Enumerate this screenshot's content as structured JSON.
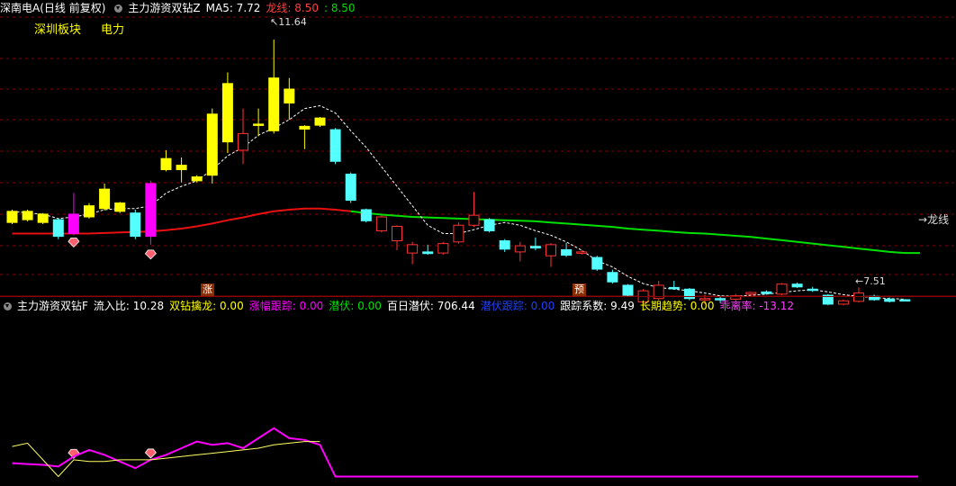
{
  "header1": {
    "stock": "深南电A(日线 前复权)",
    "indicator": "主力游资双钻Z",
    "ma5_label": "MA5: 7.72",
    "dragon_label": "龙线: 8.50",
    "dragon_value": ": 8.50"
  },
  "tags": {
    "sector": "深圳板块",
    "concept": "电力"
  },
  "annotations": {
    "high": "11.64",
    "low": "7.51",
    "dragon_line": "龙线"
  },
  "markers": {
    "zhang": "涨",
    "yu": "预"
  },
  "header2": {
    "indicator": "主力游资双钻F",
    "flow": "流入比: 10.28",
    "double_drill": "双钻擒龙: 0.00",
    "rise_track": "涨幅跟踪: 0.00",
    "lurk": "潜伏: 0.00",
    "hundred_lurk": "百日潜伏: 706.44",
    "lurk_track": "潜伏跟踪: 0.00",
    "track_coef": "跟踪系数: 9.49",
    "long_trend": "长期趋势: 0.00",
    "deviation": "乖离率: -13.12"
  },
  "colors": {
    "up_yellow": "#ffff00",
    "up_red": "#ff3232",
    "down_cyan": "#54ffff",
    "magenta": "#ff00ff",
    "dragon_red": "#e81010",
    "dragon_green": "#00e000",
    "grid": "#8b0000"
  },
  "chart_data": {
    "type": "candlestick",
    "price_range": [
      7.3,
      11.9
    ],
    "candles": [
      {
        "o": 8.35,
        "c": 8.55,
        "h": 8.58,
        "l": 8.32,
        "s": "yellow"
      },
      {
        "o": 8.4,
        "c": 8.55,
        "h": 8.58,
        "l": 8.37,
        "s": "yellow"
      },
      {
        "o": 8.35,
        "c": 8.5,
        "h": 8.52,
        "l": 8.32,
        "s": "yellow"
      },
      {
        "o": 8.4,
        "c": 8.1,
        "h": 8.42,
        "l": 8.05,
        "s": "cyan"
      },
      {
        "o": 8.15,
        "c": 8.5,
        "h": 8.88,
        "l": 8.12,
        "s": "magenta"
      },
      {
        "o": 8.45,
        "c": 8.65,
        "h": 8.7,
        "l": 8.42,
        "s": "yellow"
      },
      {
        "o": 8.6,
        "c": 8.95,
        "h": 9.05,
        "l": 8.57,
        "s": "yellow"
      },
      {
        "o": 8.55,
        "c": 8.7,
        "h": 8.72,
        "l": 8.52,
        "s": "yellow"
      },
      {
        "o": 8.52,
        "c": 8.1,
        "h": 8.58,
        "l": 8.05,
        "s": "cyan"
      },
      {
        "o": 8.1,
        "c": 9.05,
        "h": 9.1,
        "l": 7.95,
        "s": "magenta"
      },
      {
        "o": 9.3,
        "c": 9.5,
        "h": 9.65,
        "l": 9.27,
        "s": "yellow"
      },
      {
        "o": 9.3,
        "c": 9.38,
        "h": 9.52,
        "l": 9.07,
        "s": "yellow"
      },
      {
        "o": 9.1,
        "c": 9.17,
        "h": 9.2,
        "l": 9.07,
        "s": "yellow"
      },
      {
        "o": 9.2,
        "c": 10.3,
        "h": 10.4,
        "l": 9.05,
        "s": "yellow"
      },
      {
        "o": 9.8,
        "c": 10.85,
        "h": 11.05,
        "l": 9.6,
        "s": "yellow"
      },
      {
        "o": 9.65,
        "c": 9.95,
        "h": 10.4,
        "l": 9.4,
        "s": "red"
      },
      {
        "o": 10.1,
        "c": 10.12,
        "h": 10.4,
        "l": 9.9,
        "s": "yellow"
      },
      {
        "o": 10.0,
        "c": 10.95,
        "h": 11.64,
        "l": 9.95,
        "s": "yellow"
      },
      {
        "o": 10.5,
        "c": 10.75,
        "h": 10.95,
        "l": 10.2,
        "s": "yellow"
      },
      {
        "o": 10.03,
        "c": 10.08,
        "h": 10.1,
        "l": 9.67,
        "s": "yellow"
      },
      {
        "o": 10.1,
        "c": 10.23,
        "h": 10.25,
        "l": 10.07,
        "s": "yellow"
      },
      {
        "o": 10.02,
        "c": 9.45,
        "h": 10.05,
        "l": 9.4,
        "s": "cyan"
      },
      {
        "o": 9.22,
        "c": 8.75,
        "h": 9.25,
        "l": 8.7,
        "s": "cyan"
      },
      {
        "o": 8.58,
        "c": 8.38,
        "h": 8.6,
        "l": 8.35,
        "s": "cyan"
      },
      {
        "o": 8.2,
        "c": 8.45,
        "h": 8.48,
        "l": 8.17,
        "s": "red"
      },
      {
        "o": 8.02,
        "c": 8.28,
        "h": 8.3,
        "l": 7.85,
        "s": "red"
      },
      {
        "o": 7.8,
        "c": 7.95,
        "h": 8.0,
        "l": 7.6,
        "s": "red"
      },
      {
        "o": 7.82,
        "c": 7.79,
        "h": 7.95,
        "l": 7.77,
        "s": "cyan"
      },
      {
        "o": 7.8,
        "c": 7.97,
        "h": 8.0,
        "l": 7.77,
        "s": "red"
      },
      {
        "o": 8.0,
        "c": 8.3,
        "h": 8.35,
        "l": 7.97,
        "s": "red"
      },
      {
        "o": 8.3,
        "c": 8.48,
        "h": 8.9,
        "l": 8.27,
        "s": "red"
      },
      {
        "o": 8.4,
        "c": 8.2,
        "h": 8.43,
        "l": 8.17,
        "s": "cyan"
      },
      {
        "o": 8.02,
        "c": 7.87,
        "h": 8.05,
        "l": 7.82,
        "s": "cyan"
      },
      {
        "o": 7.82,
        "c": 7.93,
        "h": 8.0,
        "l": 7.65,
        "s": "red"
      },
      {
        "o": 7.92,
        "c": 7.89,
        "h": 8.08,
        "l": 7.85,
        "s": "cyan"
      },
      {
        "o": 7.75,
        "c": 7.95,
        "h": 7.98,
        "l": 7.55,
        "s": "red"
      },
      {
        "o": 7.86,
        "c": 7.76,
        "h": 7.98,
        "l": 7.73,
        "s": "cyan"
      },
      {
        "o": 7.82,
        "c": 7.8,
        "h": 7.85,
        "l": 7.77,
        "s": "red"
      },
      {
        "o": 7.72,
        "c": 7.51,
        "h": 7.75,
        "l": 7.48,
        "s": "cyan"
      },
      {
        "o": 7.45,
        "c": 7.28,
        "h": 7.5,
        "l": 7.25,
        "s": "cyan"
      },
      {
        "o": 7.22,
        "c": 7.04,
        "h": 7.24,
        "l": 7.02,
        "s": "cyan"
      },
      {
        "o": 6.92,
        "c": 7.12,
        "h": 7.15,
        "l": 6.85,
        "s": "red"
      },
      {
        "o": 6.98,
        "c": 7.22,
        "h": 7.3,
        "l": 6.95,
        "s": "red"
      },
      {
        "o": 7.18,
        "c": 7.17,
        "h": 7.3,
        "l": 7.14,
        "s": "cyan"
      },
      {
        "o": 7.15,
        "c": 6.98,
        "h": 7.17,
        "l": 6.95,
        "s": "cyan"
      },
      {
        "o": 6.98,
        "c": 6.96,
        "h": 7.05,
        "l": 6.88,
        "s": "red"
      },
      {
        "o": 6.98,
        "c": 6.96,
        "h": 7.03,
        "l": 6.9,
        "s": "cyan"
      },
      {
        "o": 6.97,
        "c": 7.03,
        "h": 7.06,
        "l": 6.95,
        "s": "red"
      },
      {
        "o": 7.06,
        "c": 7.09,
        "h": 7.1,
        "l": 7.03,
        "s": "red"
      },
      {
        "o": 7.07,
        "c": 7.1,
        "h": 7.13,
        "l": 7.05,
        "s": "cyan"
      },
      {
        "o": 7.06,
        "c": 7.24,
        "h": 7.26,
        "l": 7.04,
        "s": "red"
      },
      {
        "o": 7.24,
        "c": 7.19,
        "h": 7.27,
        "l": 7.17,
        "s": "cyan"
      },
      {
        "o": 7.15,
        "c": 7.13,
        "h": 7.19,
        "l": 7.1,
        "s": "cyan"
      },
      {
        "o": 7.04,
        "c": 6.88,
        "h": 7.06,
        "l": 6.86,
        "s": "cyan"
      },
      {
        "o": 6.88,
        "c": 6.94,
        "h": 6.96,
        "l": 6.86,
        "s": "red"
      },
      {
        "o": 6.93,
        "c": 7.08,
        "h": 7.18,
        "l": 6.91,
        "s": "red"
      },
      {
        "o": 7.02,
        "c": 6.96,
        "h": 7.05,
        "l": 6.94,
        "s": "cyan"
      },
      {
        "o": 6.97,
        "c": 6.93,
        "h": 7.0,
        "l": 6.91,
        "s": "cyan"
      },
      {
        "o": 6.96,
        "c": 6.95,
        "h": 6.97,
        "l": 6.94,
        "s": "cyan"
      }
    ],
    "ma5": [
      8.55,
      8.52,
      8.5,
      8.42,
      8.45,
      8.5,
      8.58,
      8.6,
      8.6,
      8.65,
      8.88,
      9.0,
      9.1,
      9.3,
      9.55,
      9.7,
      9.92,
      10.05,
      10.2,
      10.4,
      10.45,
      10.32,
      10.0,
      9.7,
      9.35,
      9.0,
      8.65,
      8.3,
      8.15,
      8.15,
      8.22,
      8.3,
      8.35,
      8.3,
      8.2,
      8.12,
      8.0,
      7.85,
      7.66,
      7.55,
      7.38,
      7.25,
      7.18,
      7.15,
      7.12,
      7.08,
      7.03,
      7.02,
      7.04,
      7.06,
      7.09,
      7.12,
      7.14,
      7.1,
      7.05,
      7.02,
      7.0,
      6.98,
      6.97
    ],
    "dragon_line": [
      8.15,
      8.15,
      8.15,
      8.15,
      8.15,
      8.15,
      8.16,
      8.17,
      8.18,
      8.19,
      8.21,
      8.24,
      8.28,
      8.33,
      8.39,
      8.44,
      8.5,
      8.55,
      8.58,
      8.6,
      8.6,
      8.58,
      8.55,
      8.52,
      8.49,
      8.47,
      8.45,
      8.44,
      8.43,
      8.42,
      8.41,
      8.4,
      8.39,
      8.38,
      8.37,
      8.35,
      8.33,
      8.31,
      8.29,
      8.27,
      8.24,
      8.22,
      8.2,
      8.18,
      8.16,
      8.15,
      8.13,
      8.11,
      8.09,
      8.06,
      8.03,
      8.0,
      7.97,
      7.94,
      7.91,
      7.88,
      7.85,
      7.82,
      7.8
    ],
    "dragon_split_index": 22,
    "dragon_last_value": 7.8,
    "diamond_upper_indices": [
      4,
      9
    ],
    "sub_range": [
      0,
      10
    ],
    "sub_magenta": [
      1.1,
      1.05,
      1.0,
      0.9,
      1.5,
      1.9,
      1.6,
      1.2,
      0.8,
      1.3,
      1.6,
      2.0,
      2.4,
      2.2,
      2.3,
      2.0,
      2.6,
      3.2,
      2.6,
      2.5,
      2.2,
      0.3,
      0.3,
      0.3,
      0.3,
      0.3,
      0.3,
      0.3,
      0.3,
      0.3,
      0.3,
      0.3,
      0.3,
      0.3,
      0.3,
      0.3,
      0.3,
      0.3,
      0.3,
      0.3,
      0.3,
      0.3,
      0.3,
      0.3,
      0.3,
      0.3,
      0.3,
      0.3,
      0.3,
      0.3,
      0.3,
      0.3,
      0.3,
      0.3,
      0.3,
      0.3,
      0.3,
      0.3,
      0.3
    ],
    "sub_yellow": [
      2.1,
      2.3,
      1.3,
      0.3,
      1.3,
      1.2,
      1.2,
      1.3,
      1.3,
      1.3,
      1.4,
      1.5,
      1.6,
      1.7,
      1.8,
      1.9,
      2.0,
      2.2,
      2.3,
      2.4,
      2.4,
      null
    ],
    "diamond_sub_indices": [
      4,
      9
    ]
  }
}
